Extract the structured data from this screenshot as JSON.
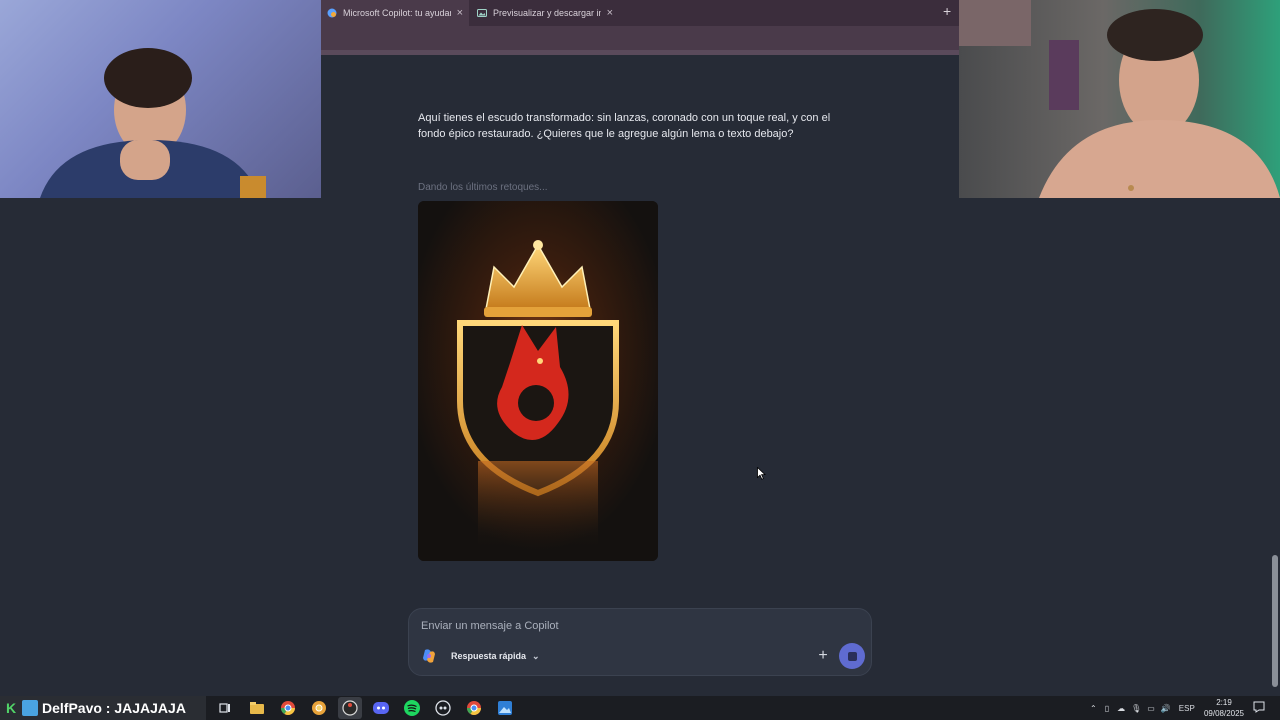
{
  "browser": {
    "tabs": [
      {
        "title": "Microsoft Copilot: tu ayudante",
        "active": true,
        "icon": "copilot-icon"
      },
      {
        "title": "Previsualizar y descargar imag",
        "active": false,
        "icon": "image-app-icon"
      }
    ]
  },
  "chat": {
    "assistant_message": "Aquí tienes el escudo transformado: sin lanzas, coronado con un toque real, y con el fondo épico restaurado. ¿Quieres que le agregue algún lema o texto debajo?",
    "status_text": "Dando los últimos retoques..."
  },
  "composer": {
    "placeholder": "Enviar un mensaje a Copilot",
    "mode_label": "Respuesta rápida"
  },
  "stream_overlay": {
    "name_text": "DelfPavo : JAJAJAJA"
  },
  "taskbar": {
    "apps": [
      "task-view-icon",
      "file-explorer-icon",
      "chrome-icon",
      "chrome-canary-icon",
      "obs-icon",
      "discord-icon",
      "spotify-icon",
      "app-icon",
      "chrome-icon",
      "photos-icon"
    ],
    "tray_lang": "ESP",
    "time": "2:19",
    "date": "09/08/2025"
  },
  "colors": {
    "page_bg": "#262b36",
    "accent": "#5f6bd0",
    "tab_bar": "#3b2d3c"
  }
}
